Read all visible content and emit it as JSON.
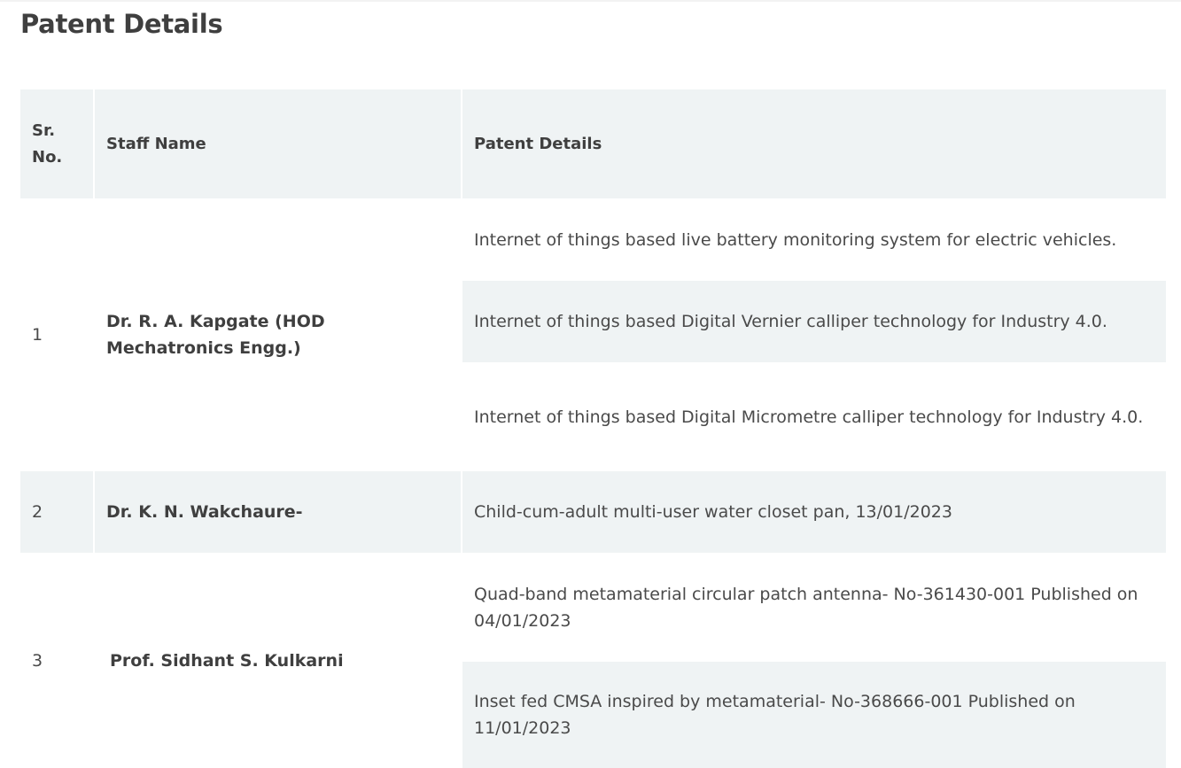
{
  "page": {
    "title": "Patent Details"
  },
  "table": {
    "headers": {
      "sr_no": "Sr. No.",
      "staff_name": "Staff Name",
      "patent_details": "Patent Details"
    },
    "rows": [
      {
        "sr": "1",
        "name": "Dr. R. A. Kapgate (HOD Mechatronics Engg.)",
        "patents": [
          "Internet of things based live battery monitoring system for electric vehicles.",
          "Internet of things based Digital Vernier calliper technology for Industry 4.0.",
          "Internet of things based Digital Micrometre calliper technology for Industry 4.0."
        ]
      },
      {
        "sr": "2",
        "name": "Dr. K. N. Wakchaure-",
        "patents": [
          "Child-cum-adult multi-user water closet pan, 13/01/2023"
        ]
      },
      {
        "sr": "3",
        "name": "Prof. Sidhant S. Kulkarni",
        "patents": [
          "Quad-band metamaterial circular patch antenna- No-361430-001 Published on 04/01/2023",
          "Inset fed CMSA inspired by metamaterial- No-368666-001 Published on 11/01/2023"
        ]
      }
    ]
  },
  "colors": {
    "stripe": "#eff3f4",
    "heading_text": "#3f3f3f",
    "body_text": "#4a4a4a"
  }
}
